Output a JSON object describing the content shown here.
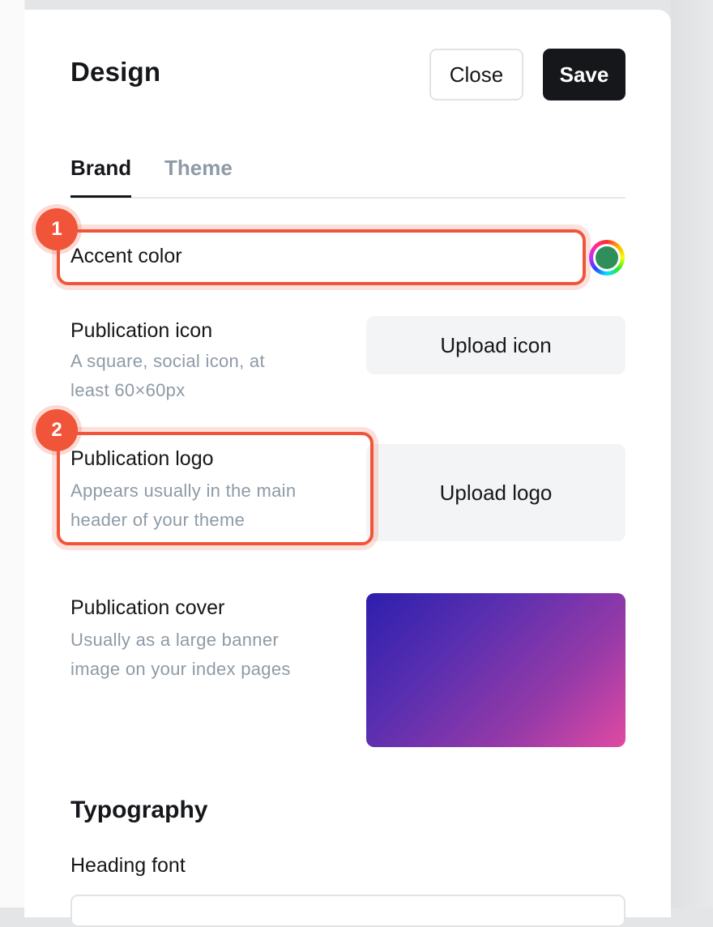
{
  "panel": {
    "title": "Design",
    "close_label": "Close",
    "save_label": "Save"
  },
  "tabs": [
    {
      "label": "Brand",
      "active": true
    },
    {
      "label": "Theme",
      "active": false
    }
  ],
  "brand": {
    "accent": {
      "label": "Accent color",
      "value": "#2f8f5b"
    },
    "icon": {
      "label": "Publication icon",
      "hint_line1": "A square, social icon, at",
      "hint_line2": "least 60×60px",
      "button": "Upload icon"
    },
    "logo": {
      "label": "Publication logo",
      "hint_line1": "Appears usually in the main",
      "hint_line2": "header of your theme",
      "button": "Upload logo"
    },
    "cover": {
      "label": "Publication cover",
      "hint_line1": "Usually as a large banner",
      "hint_line2": "image on your index pages",
      "gradient_start": "#2d1fae",
      "gradient_end": "#e04aa2"
    }
  },
  "typography": {
    "title": "Typography",
    "heading_font_label": "Heading font"
  },
  "annotations": [
    {
      "number": "1",
      "target": "Accent color"
    },
    {
      "number": "2",
      "target": "Publication logo"
    }
  ],
  "colors": {
    "annotation": "#f0553a",
    "primary_button": "#15171a",
    "muted_text": "#8e9aa6"
  }
}
